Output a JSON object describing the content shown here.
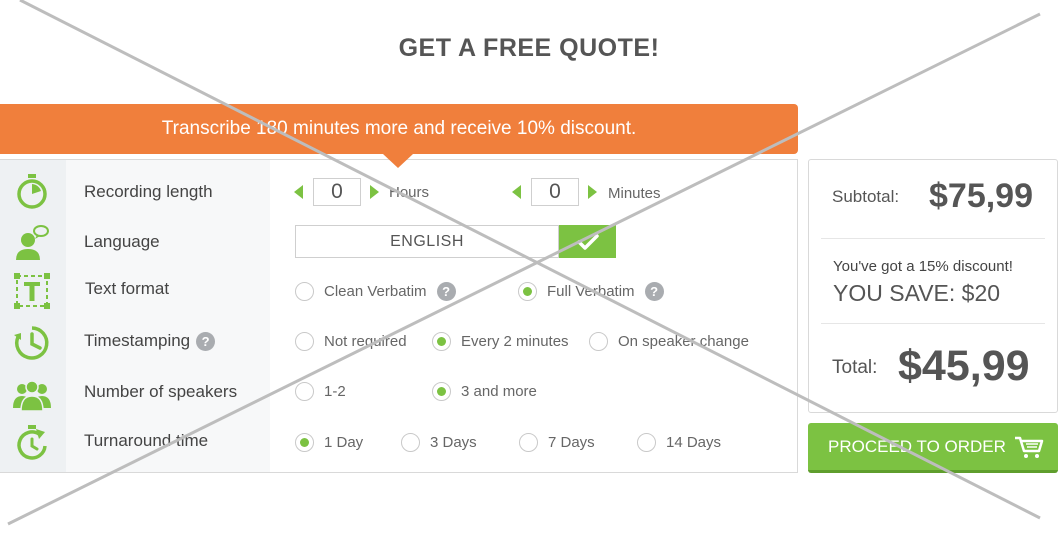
{
  "title": "GET A FREE QUOTE!",
  "banner": "Transcribe 180 minutes more and receive 10% discount.",
  "rows": {
    "recording_length": "Recording length",
    "language": "Language",
    "text_format": "Text format",
    "timestamping": "Timestamping",
    "speakers": "Number of speakers",
    "turnaround": "Turnaround time"
  },
  "help_mark": "?",
  "recording": {
    "hours": "0",
    "hours_label": "Hours",
    "minutes": "0",
    "minutes_label": "Minutes"
  },
  "language_value": "ENGLISH",
  "text_format_options": [
    "Clean Verbatim",
    "Full Verbatim"
  ],
  "timestamping_options": [
    "Not required",
    "Every 2 minutes",
    "On speaker change"
  ],
  "speaker_options": [
    "1-2",
    "3 and more"
  ],
  "turnaround_options": [
    "1 Day",
    "3 Days",
    "7 Days",
    "14 Days"
  ],
  "selected": {
    "text_format": "Full Verbatim",
    "timestamping": "Every 2 minutes",
    "speakers": "3 and more",
    "turnaround": "1 Day"
  },
  "summary": {
    "subtotal_label": "Subtotal:",
    "subtotal_value": "$75,99",
    "discount_text": "You've got a 15% discount!",
    "save_text": "YOU SAVE: $20",
    "total_label": "Total:",
    "total_value": "$45,99"
  },
  "proceed_label": "PROCEED TO ORDER",
  "colors": {
    "orange": "#f07f3c",
    "green": "#7cc242",
    "text": "#4a4a4a"
  },
  "icons": [
    "stopwatch-icon",
    "user-speech-icon",
    "text-format-icon",
    "clock-timestamp-icon",
    "group-icon",
    "turnaround-icon",
    "check-icon",
    "cart-icon"
  ]
}
